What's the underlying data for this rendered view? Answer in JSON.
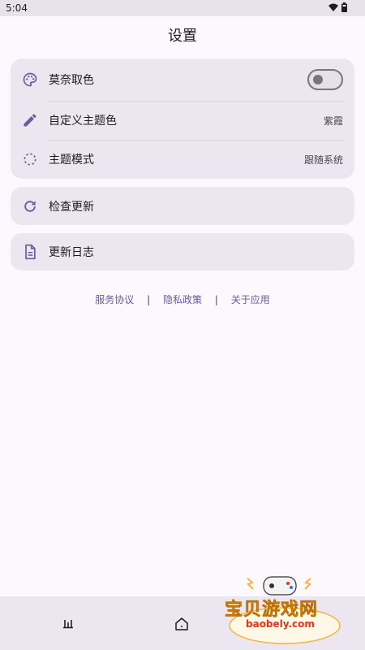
{
  "status": {
    "time": "5:04"
  },
  "header": {
    "title": "设置"
  },
  "theme_card": {
    "monet": {
      "label": "莫奈取色",
      "enabled": false
    },
    "custom_color": {
      "label": "自定义主题色",
      "value": "紫霞"
    },
    "theme_mode": {
      "label": "主题模式",
      "value": "跟随系统"
    }
  },
  "update_card": {
    "label": "检查更新"
  },
  "changelog_card": {
    "label": "更新日志"
  },
  "footer_links": {
    "terms": "服务协议",
    "privacy": "隐私政策",
    "about": "关于应用",
    "separator": "|"
  },
  "watermark": {
    "brand": "宝贝游戏网",
    "url": "baobely.com"
  },
  "colors": {
    "accent": "#6b5b9a",
    "card": "#ebe6ef",
    "background": "#fdf8fd"
  }
}
